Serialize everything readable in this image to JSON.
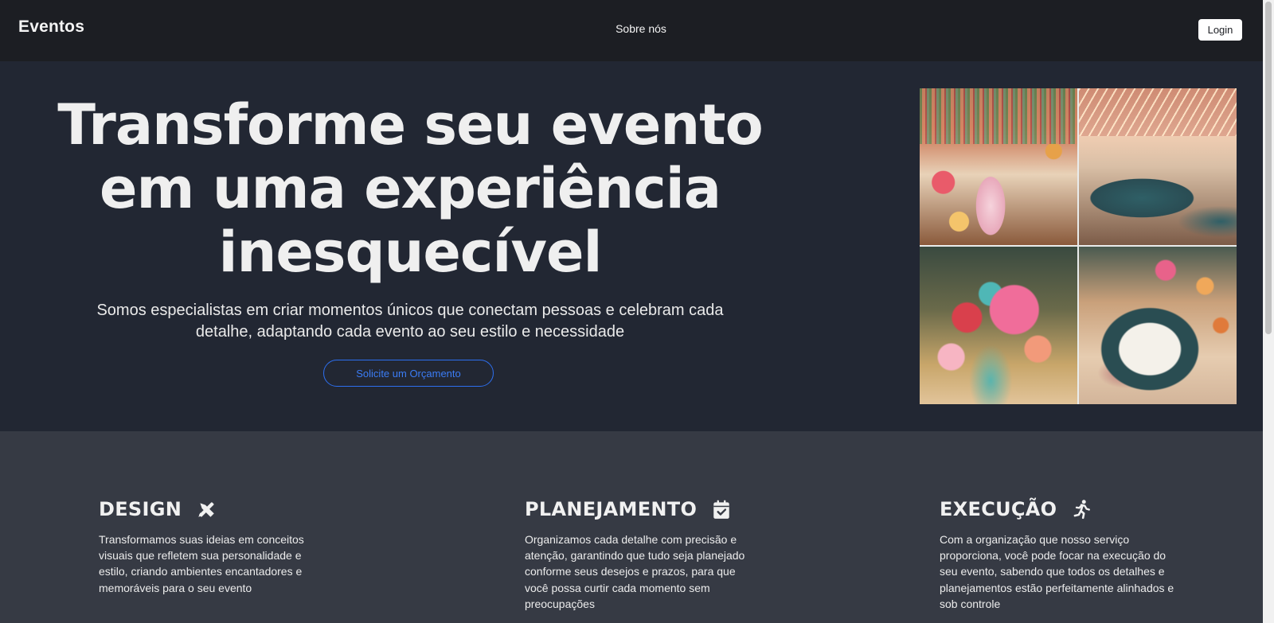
{
  "header": {
    "brand": "Eventos",
    "nav_about": "Sobre nós",
    "login_label": "Login"
  },
  "hero": {
    "title": "Transforme seu evento em uma experiência inesquecível",
    "subtitle": "Somos especialistas em criar momentos únicos que conectam pessoas e celebram cada detalhe, adaptando cada evento ao seu estilo e necessidade",
    "cta_label": "Solicite um Orçamento",
    "accent_color": "#2d6ff0"
  },
  "features": [
    {
      "title": "DESIGN",
      "icon": "design-tools-icon",
      "text": "Transformamos suas ideias em conceitos visuais que refletem sua personalidade e estilo, criando ambientes encantadores e memoráveis para o seu evento"
    },
    {
      "title": "PLANEJAMENTO",
      "icon": "calendar-check-icon",
      "text": "Organizamos cada detalhe com precisão e atenção, garantindo que tudo seja planejado conforme seus desejos e prazos, para que você possa curtir cada momento sem preocupações"
    },
    {
      "title": "EXECUÇÃO",
      "icon": "running-person-icon",
      "text": "Com a organização que nosso serviço proporciona, você pode focar na execução do seu evento, sabendo que todos os detalhes e planejamentos estão perfeitamente alinhados e sob controle"
    }
  ]
}
